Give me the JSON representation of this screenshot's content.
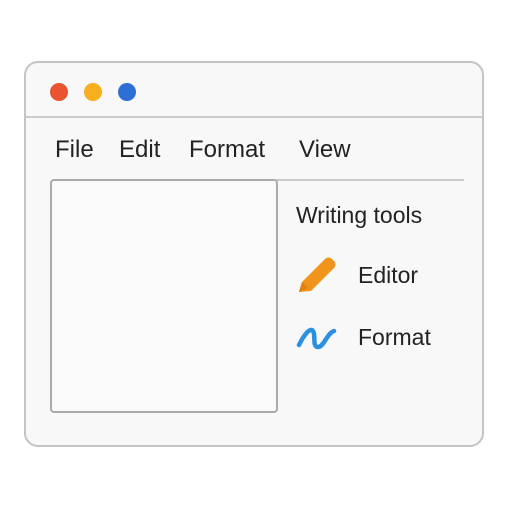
{
  "window": {
    "controls": [
      {
        "name": "close",
        "color": "#e8542f"
      },
      {
        "name": "minimize",
        "color": "#f5b01c"
      },
      {
        "name": "maximize",
        "color": "#2e6fd6"
      }
    ]
  },
  "menu": {
    "items": [
      {
        "label": "File"
      },
      {
        "label": "Edit"
      },
      {
        "label": "Format"
      },
      {
        "label": "View"
      }
    ]
  },
  "tools_panel": {
    "title": "Writing tools",
    "items": [
      {
        "label": "Editor",
        "icon": "pencil-icon",
        "color": "#f0941c"
      },
      {
        "label": "Format",
        "icon": "squiggle-icon",
        "color": "#2c8fe0"
      }
    ]
  }
}
